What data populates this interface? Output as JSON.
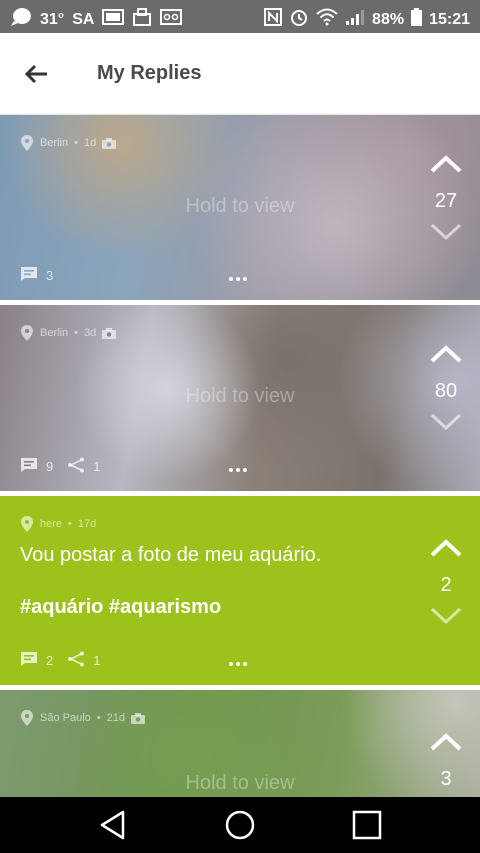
{
  "status_bar": {
    "temperature": "31°",
    "day": "SA",
    "battery": "88%",
    "time": "15:21"
  },
  "header": {
    "title": "My Replies"
  },
  "posts": [
    {
      "location": "Berlin",
      "age": "1d",
      "overlay_text": "Hold to view",
      "votes": "27",
      "comments": "3",
      "shares": ""
    },
    {
      "location": "Berlin",
      "age": "3d",
      "overlay_text": "Hold to view",
      "votes": "80",
      "comments": "9",
      "shares": "1"
    },
    {
      "location": "here",
      "age": "17d",
      "text": "Vou postar a foto de meu aquário.",
      "hashtags": "#aquário #aquarismo",
      "votes": "2",
      "comments": "2",
      "shares": "1",
      "color": "#9ec21c"
    },
    {
      "location": "São Paulo",
      "age": "21d",
      "overlay_text": "Hold to view",
      "votes": "3"
    }
  ],
  "separator": "•"
}
